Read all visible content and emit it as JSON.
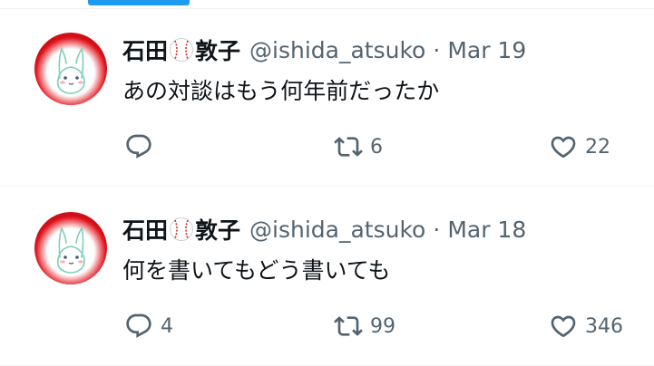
{
  "tweets": [
    {
      "name_part1": "石田",
      "name_part2": "敦子",
      "handle": "@ishida_atsuko",
      "separator": "·",
      "date": "Mar 19",
      "text": "あの対談はもう何年前だったか",
      "replies": "",
      "retweets": "6",
      "likes": "22"
    },
    {
      "name_part1": "石田",
      "name_part2": "敦子",
      "handle": "@ishida_atsuko",
      "separator": "·",
      "date": "Mar 18",
      "text": "何を書いてもどう書いても",
      "replies": "4",
      "retweets": "99",
      "likes": "346"
    }
  ],
  "colors": {
    "accent": "#1d9bf0",
    "secondary_text": "#536471",
    "avatar_red": "#e31b23"
  },
  "icons": [
    "reply-icon",
    "retweet-icon",
    "like-icon",
    "baseball-icon"
  ]
}
